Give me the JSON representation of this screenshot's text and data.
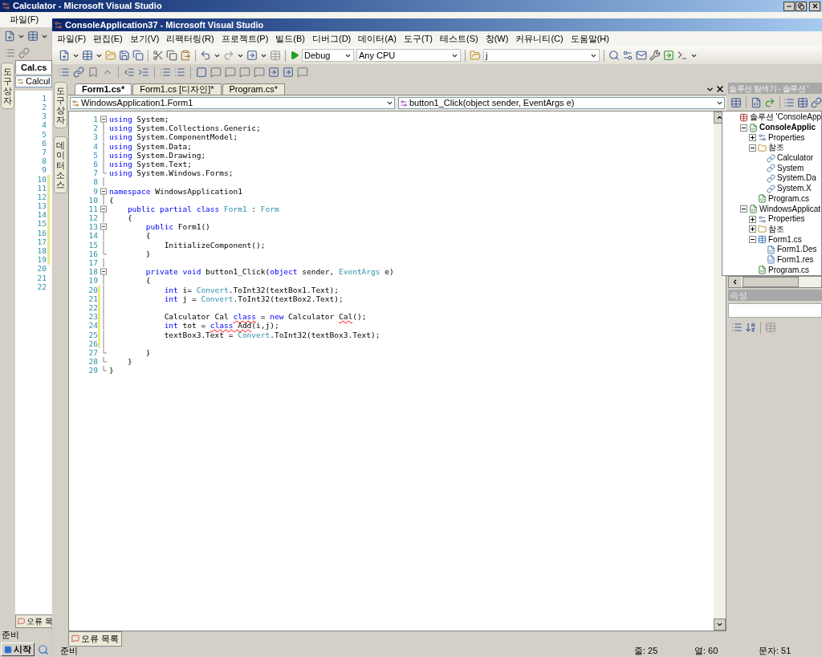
{
  "back_window": {
    "title": "Calculator - Microsoft Visual Studio",
    "menu": [
      "파일(F)"
    ],
    "side_tab": "도구 상자",
    "tabs": [
      {
        "label": "Cal.cs",
        "selected": true
      }
    ],
    "type_combo": "Calcul",
    "lines": [
      {
        "n": "1",
        "changed": false
      },
      {
        "n": "2",
        "changed": false
      },
      {
        "n": "3",
        "changed": false
      },
      {
        "n": "4",
        "changed": false
      },
      {
        "n": "5",
        "changed": false
      },
      {
        "n": "6",
        "changed": false
      },
      {
        "n": "7",
        "changed": false
      },
      {
        "n": "8",
        "changed": false
      },
      {
        "n": "9",
        "changed": false
      },
      {
        "n": "10",
        "changed": true
      },
      {
        "n": "11",
        "changed": true
      },
      {
        "n": "12",
        "changed": true
      },
      {
        "n": "13",
        "changed": true
      },
      {
        "n": "14",
        "changed": true
      },
      {
        "n": "15",
        "changed": true
      },
      {
        "n": "16",
        "changed": true
      },
      {
        "n": "17",
        "changed": true
      },
      {
        "n": "18",
        "changed": true
      },
      {
        "n": "19",
        "changed": true
      },
      {
        "n": "20",
        "changed": false
      },
      {
        "n": "21",
        "changed": false
      },
      {
        "n": "22",
        "changed": false
      }
    ],
    "bottom_tab": "오류 목",
    "status": "준비"
  },
  "window": {
    "title": "ConsoleApplication37 - Microsoft Visual Studio",
    "menu": [
      "파일(F)",
      "편집(E)",
      "보기(V)",
      "리팩터링(R)",
      "프로젝트(P)",
      "빌드(B)",
      "디버그(D)",
      "데이터(A)",
      "도구(T)",
      "테스트(S)",
      "창(W)",
      "커뮤니티(C)",
      "도움말(H)"
    ],
    "toolbar": {
      "configuration": "Debug",
      "platform": "Any CPU",
      "find": "j"
    },
    "side_tabs": [
      "도구 상자",
      "데이터 소스"
    ],
    "editor": {
      "tabs": [
        {
          "label": "Form1.cs*",
          "selected": true
        },
        {
          "label": "Form1.cs [디자인]*",
          "selected": false
        },
        {
          "label": "Program.cs*",
          "selected": false
        }
      ],
      "type_combo": "WindowsApplication1.Form1",
      "member_combo": "button1_Click(object sender, EventArgs e)",
      "lines": [
        {
          "n": "1",
          "collapsible": true,
          "block_end": false,
          "changed": false,
          "tokens": [
            {
              "kind": "kw",
              "text": "using"
            },
            {
              "kind": "plain",
              "text": " System;"
            }
          ]
        },
        {
          "n": "2",
          "collapsible": false,
          "block_end": false,
          "changed": false,
          "tokens": [
            {
              "kind": "kw",
              "text": "using"
            },
            {
              "kind": "plain",
              "text": " System.Collections.Generic;"
            }
          ]
        },
        {
          "n": "3",
          "collapsible": false,
          "block_end": false,
          "changed": false,
          "tokens": [
            {
              "kind": "kw",
              "text": "using"
            },
            {
              "kind": "plain",
              "text": " System.ComponentModel;"
            }
          ]
        },
        {
          "n": "4",
          "collapsible": false,
          "block_end": false,
          "changed": false,
          "tokens": [
            {
              "kind": "kw",
              "text": "using"
            },
            {
              "kind": "plain",
              "text": " System.Data;"
            }
          ]
        },
        {
          "n": "5",
          "collapsible": false,
          "block_end": false,
          "changed": false,
          "tokens": [
            {
              "kind": "kw",
              "text": "using"
            },
            {
              "kind": "plain",
              "text": " System.Drawing;"
            }
          ]
        },
        {
          "n": "6",
          "collapsible": false,
          "block_end": false,
          "changed": false,
          "tokens": [
            {
              "kind": "kw",
              "text": "using"
            },
            {
              "kind": "plain",
              "text": " System.Text;"
            }
          ]
        },
        {
          "n": "7",
          "collapsible": false,
          "block_end": true,
          "changed": false,
          "tokens": [
            {
              "kind": "kw",
              "text": "using"
            },
            {
              "kind": "plain",
              "text": " System.Windows.Forms;"
            }
          ]
        },
        {
          "n": "8",
          "collapsible": false,
          "block_end": false,
          "changed": false
        },
        {
          "n": "9",
          "collapsible": true,
          "block_end": false,
          "changed": false,
          "tokens": [
            {
              "kind": "kw",
              "text": "namespace"
            },
            {
              "kind": "plain",
              "text": " WindowsApplication1"
            }
          ]
        },
        {
          "n": "10",
          "collapsible": false,
          "block_end": false,
          "changed": false,
          "tokens": [
            {
              "kind": "plain",
              "text": "{"
            }
          ]
        },
        {
          "n": "11",
          "collapsible": true,
          "block_end": false,
          "changed": false,
          "tokens": [
            {
              "kind": "kw",
              "text": "    public partial class"
            },
            {
              "kind": "type",
              "text": " Form1"
            },
            {
              "kind": "plain",
              "text": " :"
            },
            {
              "kind": "type",
              "text": " Form"
            }
          ]
        },
        {
          "n": "12",
          "collapsible": false,
          "block_end": false,
          "changed": false,
          "tokens": [
            {
              "kind": "plain",
              "text": "    {"
            }
          ]
        },
        {
          "n": "13",
          "collapsible": true,
          "block_end": false,
          "changed": false,
          "tokens": [
            {
              "kind": "kw",
              "text": "        public"
            },
            {
              "kind": "plain",
              "text": " Form1()"
            }
          ]
        },
        {
          "n": "14",
          "collapsible": false,
          "block_end": false,
          "changed": false,
          "tokens": [
            {
              "kind": "plain",
              "text": "        {"
            }
          ]
        },
        {
          "n": "15",
          "collapsible": false,
          "block_end": false,
          "changed": false,
          "tokens": [
            {
              "kind": "plain",
              "text": "            InitializeComponent();"
            }
          ]
        },
        {
          "n": "16",
          "collapsible": false,
          "block_end": true,
          "changed": false,
          "tokens": [
            {
              "kind": "plain",
              "text": "        }"
            }
          ]
        },
        {
          "n": "17",
          "collapsible": false,
          "block_end": false,
          "changed": false
        },
        {
          "n": "18",
          "collapsible": true,
          "block_end": false,
          "changed": false,
          "tokens": [
            {
              "kind": "kw",
              "text": "        private void"
            },
            {
              "kind": "plain",
              "text": " button1_Click("
            },
            {
              "kind": "kw",
              "text": "object"
            },
            {
              "kind": "plain",
              "text": " sender,"
            },
            {
              "kind": "type",
              "text": " EventArgs"
            },
            {
              "kind": "plain",
              "text": " e)"
            }
          ]
        },
        {
          "n": "19",
          "collapsible": false,
          "block_end": false,
          "changed": false,
          "tokens": [
            {
              "kind": "plain",
              "text": "        {"
            }
          ]
        },
        {
          "n": "20",
          "collapsible": false,
          "block_end": false,
          "changed": true,
          "tokens": [
            {
              "kind": "kw",
              "text": "            int"
            },
            {
              "kind": "plain",
              "text": " i="
            },
            {
              "kind": "type",
              "text": " Convert"
            },
            {
              "kind": "plain",
              "text": ".ToInt32(textBox1.Text);"
            }
          ]
        },
        {
          "n": "21",
          "collapsible": false,
          "block_end": false,
          "changed": true,
          "tokens": [
            {
              "kind": "kw",
              "text": "            int"
            },
            {
              "kind": "plain",
              "text": " j ="
            },
            {
              "kind": "type",
              "text": " Convert"
            },
            {
              "kind": "plain",
              "text": ".ToInt32(textBox2.Text);"
            }
          ]
        },
        {
          "n": "22",
          "collapsible": false,
          "block_end": false,
          "changed": true
        },
        {
          "n": "23",
          "collapsible": false,
          "block_end": false,
          "changed": true,
          "tokens": [
            {
              "kind": "plain",
              "text": "            Calculator Cal "
            },
            {
              "kind": "kw_error",
              "text": "class"
            },
            {
              "kind": "plain",
              "text": " ="
            },
            {
              "kind": "kw",
              "text": " new"
            },
            {
              "kind": "plain",
              "text": " Calculator "
            },
            {
              "kind": "error",
              "text": "Cal"
            },
            {
              "kind": "plain",
              "text": "();"
            }
          ]
        },
        {
          "n": "24",
          "collapsible": false,
          "block_end": false,
          "changed": true,
          "tokens": [
            {
              "kind": "kw",
              "text": "            int"
            },
            {
              "kind": "plain",
              "text": " tot = "
            },
            {
              "kind": "kw_error",
              "text": "class"
            },
            {
              "kind": "error",
              "text": " Add"
            },
            {
              "kind": "plain",
              "text": "(i,j);"
            }
          ]
        },
        {
          "n": "25",
          "collapsible": false,
          "block_end": false,
          "changed": true,
          "tokens": [
            {
              "kind": "plain",
              "text": "            textBox3.Text ="
            },
            {
              "kind": "type",
              "text": " Convert"
            },
            {
              "kind": "plain",
              "text": ".ToInt32(textBox3.Text);"
            }
          ]
        },
        {
          "n": "26",
          "collapsible": false,
          "block_end": false,
          "changed": true
        },
        {
          "n": "27",
          "collapsible": false,
          "block_end": true,
          "changed": false,
          "tokens": [
            {
              "kind": "plain",
              "text": "        }"
            }
          ]
        },
        {
          "n": "28",
          "collapsible": false,
          "block_end": true,
          "changed": false,
          "tokens": [
            {
              "kind": "plain",
              "text": "    }"
            }
          ]
        },
        {
          "n": "29",
          "collapsible": false,
          "block_end": true,
          "changed": false,
          "tokens": [
            {
              "kind": "plain",
              "text": "}"
            }
          ]
        }
      ]
    },
    "bottom_tab": "오류 목록",
    "solution_explorer": {
      "title": "솔루션 탐색기 - 솔루션 '",
      "tree": [
        {
          "label": "솔루션 'ConsoleApp",
          "kind": "solution",
          "children": [
            {
              "label": "ConsoleApplic",
              "kind": "project",
              "startup": true,
              "expanded": true,
              "children": [
                {
                  "label": "Properties",
                  "kind": "properties",
                  "expanded": false
                },
                {
                  "label": "참조",
                  "kind": "folder",
                  "expanded": true,
                  "children": [
                    {
                      "label": "Calculator",
                      "kind": "reference"
                    },
                    {
                      "label": "System",
                      "kind": "reference"
                    },
                    {
                      "label": "System.Da",
                      "kind": "reference"
                    },
                    {
                      "label": "System.X",
                      "kind": "reference"
                    }
                  ]
                },
                {
                  "label": "Program.cs",
                  "kind": "code"
                }
              ]
            },
            {
              "label": "WindowsApplicat",
              "kind": "project",
              "startup": false,
              "expanded": true,
              "children": [
                {
                  "label": "Properties",
                  "kind": "properties",
                  "expanded": false
                },
                {
                  "label": "참조",
                  "kind": "folder",
                  "expanded": false
                },
                {
                  "label": "Form1.cs",
                  "kind": "form",
                  "expanded": true,
                  "children": [
                    {
                      "label": "Form1.Des",
                      "kind": "subfile"
                    },
                    {
                      "label": "Form1.res",
                      "kind": "subfile"
                    }
                  ]
                },
                {
                  "label": "Program.cs",
                  "kind": "code"
                }
              ]
            }
          ]
        }
      ]
    },
    "properties": {
      "title": "속성"
    },
    "status_bar": {
      "message": "준비",
      "line": "줄: 25",
      "column": "열: 60",
      "char": "문자: 51"
    }
  },
  "taskbar": {
    "start": "시작"
  }
}
